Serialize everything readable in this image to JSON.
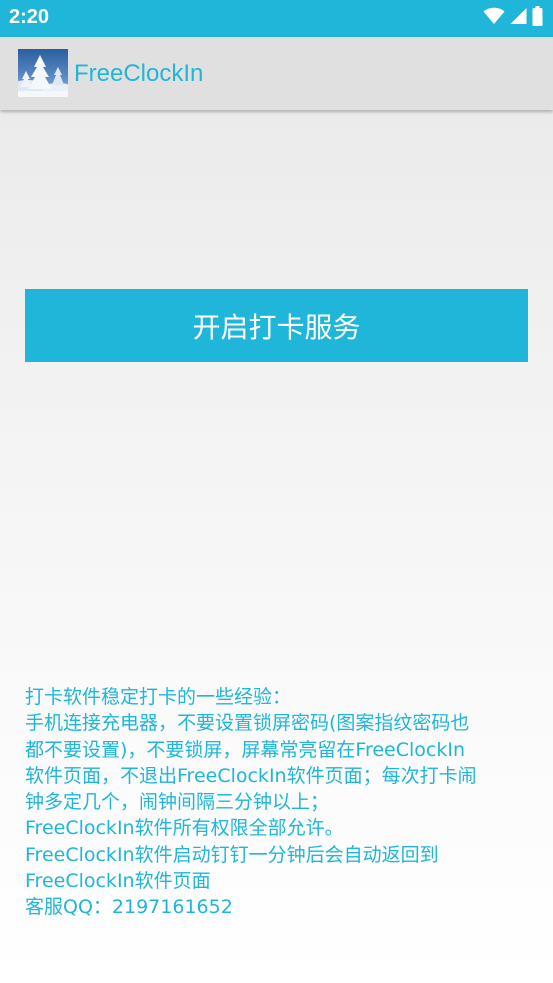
{
  "status_bar": {
    "time": "2:20",
    "icons": [
      "wifi-icon",
      "cell-signal-icon",
      "battery-icon"
    ],
    "color": "#1fb6d9"
  },
  "app_bar": {
    "icon": "snowy-tree-app-icon",
    "title": "FreeClockIn",
    "title_color": "#1fb6d9"
  },
  "main": {
    "start_button_label": "开启打卡服务",
    "tips": [
      "打卡软件稳定打卡的一些经验：",
      "手机连接充电器，不要设置锁屏密码(图案指纹密码也",
      "都不要设置)，不要锁屏，屏幕常亮留在FreeClockIn",
      "软件页面，不退出FreeClockIn软件页面；每次打卡闹",
      "钟多定几个，闹钟间隔三分钟以上；",
      "FreeClockIn软件所有权限全部允许。",
      "FreeClockIn软件启动钉钉一分钟后会自动返回到",
      "FreeClockIn软件页面",
      "客服QQ：2197161652"
    ]
  }
}
